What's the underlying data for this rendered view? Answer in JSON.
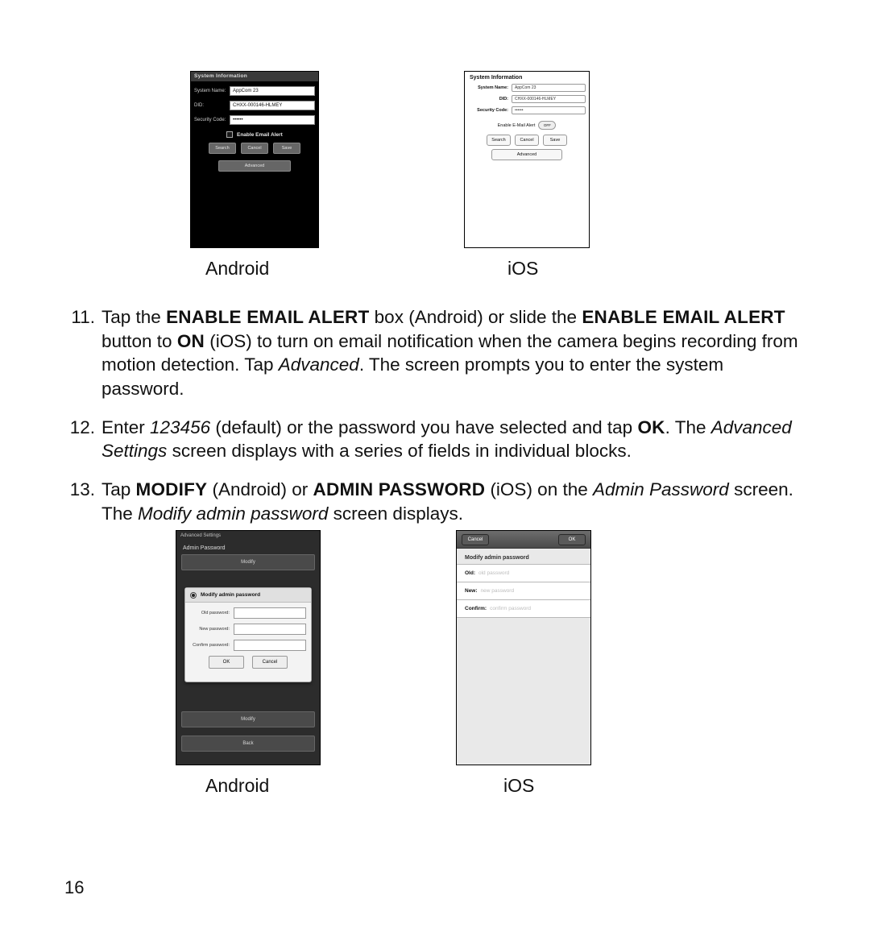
{
  "captions": {
    "android": "Android",
    "ios": "iOS"
  },
  "android_sys": {
    "title": "System Information",
    "name_label": "System Name:",
    "name_value": "AppCom 23",
    "did_label": "DID:",
    "did_value": "CHXX-000146-HLMEY",
    "sec_label": "Security Code:",
    "sec_value": "••••••",
    "enable_label": "Enable Email Alert",
    "btn_search": "Search",
    "btn_cancel": "Cancel",
    "btn_save": "Save",
    "btn_advanced": "Advanced"
  },
  "ios_sys": {
    "title": "System Information",
    "name_label": "System Name:",
    "name_value": "AppCom 23",
    "did_label": "DID:",
    "did_value": "CHXX-000146-HLMEY",
    "sec_label": "Security Code:",
    "sec_value": "••••••",
    "enable_label": "Enable E-Mail Alert",
    "toggle_text": "OFF",
    "btn_search": "Search",
    "btn_cancel": "Cancel",
    "btn_save": "Save",
    "btn_advanced": "Advanced"
  },
  "li11": {
    "num": "11.",
    "a": "Tap the ",
    "enable1": "ENABLE EMAIL ALERT",
    "b": " box (Android) or slide the ",
    "enable2": "ENABLE EMAIL ALERT",
    "c": " button to ",
    "on": "ON",
    "d": " (iOS) to turn on email notification when the camera begins recording from motion detection. Tap ",
    "adv": "Advanced",
    "e": ". The screen prompts you to enter the system password."
  },
  "li12": {
    "num": "12.",
    "a": "Enter ",
    "pw": "123456",
    "b": " (default) or the password you have selected and tap ",
    "ok": "OK",
    "c": ". The ",
    "advset": "Advanced Settings",
    "d": " screen displays with a series of fields in individual blocks."
  },
  "li13": {
    "num": "13.",
    "a": "Tap ",
    "modify": "MODIFY",
    "b": " (Android) or ",
    "adminpw": "ADMIN PASSWORD",
    "c": " (iOS) on the ",
    "admin_screen": "Admin Password",
    "d": " screen. The ",
    "map": "Modify admin password",
    "e": " screen displays."
  },
  "android_pw": {
    "top": "Advanced Settings",
    "section": "Admin Password",
    "modify": "Modify",
    "modal_title": "Modify admin password",
    "old": "Old password:",
    "new": "New password:",
    "confirm": "Confirm password:",
    "ok": "OK",
    "cancel": "Cancel",
    "modify2": "Modify",
    "back": "Back"
  },
  "ios_pw": {
    "cancel": "Cancel",
    "ok": "OK",
    "heading": "Modify admin password",
    "old_l": "Old:",
    "old_ph": "old password",
    "new_l": "New:",
    "new_ph": "new password",
    "conf_l": "Confirm:",
    "conf_ph": "confirm password"
  },
  "page_number": "16"
}
